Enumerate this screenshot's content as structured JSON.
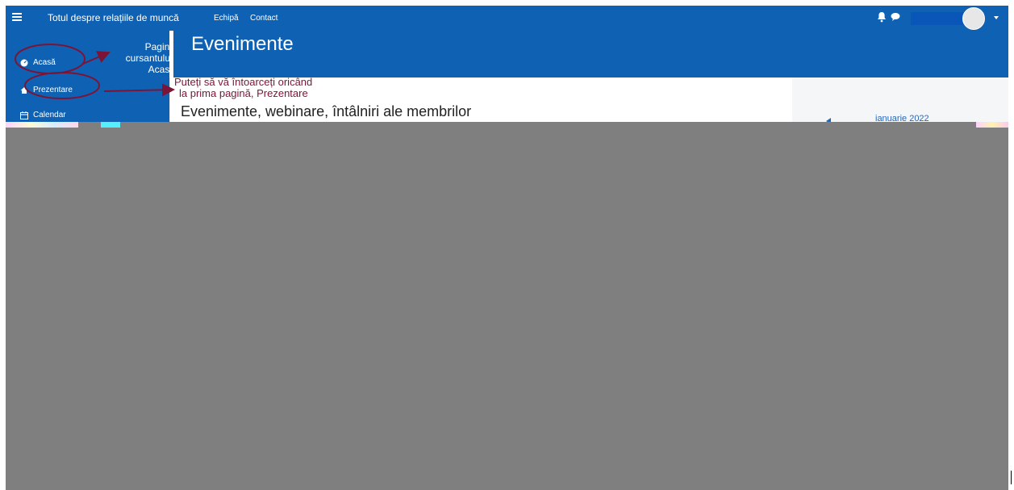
{
  "topbar": {
    "title": "Totul despre relațiile de muncă",
    "links": [
      "Echipă",
      "Contact"
    ]
  },
  "sidebar": {
    "items": [
      {
        "label": "Acasă",
        "icon": "dashboard-icon"
      },
      {
        "label": "Prezentare",
        "icon": "home-icon"
      },
      {
        "label": "Calendar",
        "icon": "calendar-icon"
      }
    ],
    "pagina_label_lines": [
      "Pagina",
      "cursantului,",
      "Acasă"
    ]
  },
  "main": {
    "page_title": "Evenimente",
    "hint_line1": "Puteți să vă întoarceți oricând",
    "hint_line2": "la prima pagină, Prezentare",
    "events_title": "Evenimente, webinare, întâlniri ale membrilor"
  },
  "calendar": {
    "month": "ianuarie 2022"
  },
  "colors": {
    "primary": "#0f62b3",
    "annotation": "#7a1537",
    "overlay": "#7f7f7f"
  }
}
